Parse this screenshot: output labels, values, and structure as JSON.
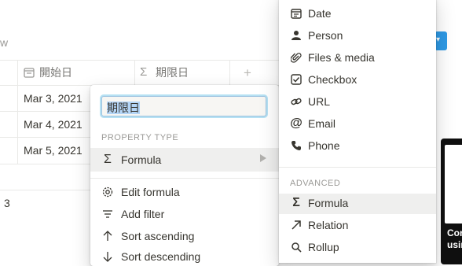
{
  "view": {
    "label": "w"
  },
  "table": {
    "columns": [
      {
        "label": "開始日",
        "icon": "calendar-icon"
      },
      {
        "label": "期限日",
        "icon": "sigma-icon"
      }
    ],
    "add_column_icon": "+",
    "rows": [
      "Mar 3, 2021",
      "Mar 4, 2021",
      "Mar 5, 2021"
    ],
    "count": "3"
  },
  "property_popup": {
    "name_value": "期限日",
    "property_type_label": "PROPERTY TYPE",
    "type_value": "Formula",
    "actions": [
      {
        "label": "Edit formula",
        "icon": "gear-icon"
      },
      {
        "label": "Add filter",
        "icon": "filter-icon"
      },
      {
        "label": "Sort ascending",
        "icon": "arrow-up-icon"
      },
      {
        "label": "Sort descending",
        "icon": "arrow-down-icon"
      }
    ]
  },
  "type_menu": {
    "basic_items": [
      {
        "label": "Date",
        "icon": "calendar-icon"
      },
      {
        "label": "Person",
        "icon": "person-icon"
      },
      {
        "label": "Files & media",
        "icon": "paperclip-icon"
      },
      {
        "label": "Checkbox",
        "icon": "checkbox-icon"
      },
      {
        "label": "URL",
        "icon": "link-icon"
      },
      {
        "label": "Email",
        "icon": "at-icon"
      },
      {
        "label": "Phone",
        "icon": "phone-icon"
      }
    ],
    "advanced_label": "ADVANCED",
    "advanced_items": [
      {
        "label": "Formula",
        "icon": "sigma-icon",
        "selected": true
      },
      {
        "label": "Relation",
        "icon": "arrow-up-right-icon"
      },
      {
        "label": "Rollup",
        "icon": "search-icon"
      }
    ]
  },
  "tooltip": {
    "line1": "Con",
    "line2": "usin"
  },
  "colors": {
    "accent": "#2e9ae6",
    "hover": "#efefee",
    "text": "#37352f",
    "muted": "#9b9a97"
  }
}
